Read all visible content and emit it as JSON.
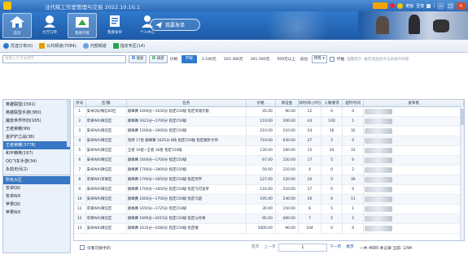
{
  "window": {
    "title": "注代练工作室管理与交易 2022.10.10.1",
    "controls": [
      "—",
      "□",
      "×"
    ]
  },
  "titlebar_right": {
    "user_label": "老板",
    "vip_label": "至尊",
    "separator": "|"
  },
  "ribbon": {
    "nav": [
      {
        "label": "首页",
        "icon": "home-icon"
      },
      {
        "label": "大厅订单",
        "icon": "order-hall-icon"
      },
      {
        "label": "我要代练",
        "icon": "level-up-icon"
      },
      {
        "label": "我要发单",
        "icon": "publish-doc-icon"
      },
      {
        "label": "个人中心",
        "icon": "user-icon"
      }
    ],
    "publish_button": "我要发单"
  },
  "tabs": [
    {
      "label": "优选订单(0)",
      "icon": "star-circle-icon",
      "color": "#2f79cc"
    },
    {
      "label": "公共频道(7084)",
      "icon": "broadcast-icon",
      "color": "#2f79cc"
    },
    {
      "label": "内部频道",
      "icon": "wifi-icon",
      "color": "#2f79cc"
    },
    {
      "label": "指定专区(14)",
      "icon": "check-icon",
      "color": "#2aa34a"
    }
  ],
  "filters": {
    "search_placeholder": "请输入订单关键字",
    "search_button": "搜索",
    "refresh_button": "刷新",
    "price_label": "价格:",
    "price_options": [
      "不限",
      "1-100元",
      "101-300元",
      "301-500元",
      "500元以上"
    ],
    "price_selected": "不限",
    "rank_label": "段位:",
    "rank_value": "所有",
    "checkbox_label": "代抽",
    "hint": "温馨提示: 推荐请直接点击表格内标题"
  },
  "sidebar": {
    "top_items": [
      "英雄联盟(1561)",
      "英雄联盟手游(380)",
      "魔兽世界怀旧(165)",
      "王者荣耀(99)",
      "金铲铲之战(38)",
      "王者荣耀(3778)",
      "和平精英(197)",
      "QQ飞车手游(34)",
      "永劫无间(2)"
    ],
    "selected_index": 5,
    "region_items": [
      "所有大区",
      "安卓QQ",
      "安卓WX",
      "苹果QQ",
      "苹果WX"
    ],
    "region_selected_index": 0
  },
  "table": {
    "columns": [
      "序号",
      "区/服",
      "任务",
      "价格",
      "保证金",
      "效时间(小时)",
      "入数要求",
      "超时时间",
      "发布者"
    ],
    "rows": [
      {
        "no": "1",
        "region": "安卓QQ/微信60区",
        "task": "巅峰赛 1600分~1650分 指定150级 指定英雄元歌",
        "price": "45.00",
        "deposit": "90.00",
        "hours": "12",
        "req": "0",
        "timeout": "0"
      },
      {
        "no": "2",
        "region": "苹果WX/微信区",
        "task": "巅峰赛 1621分~1700分 指定150级",
        "price": "110.00",
        "deposit": "200.00",
        "hours": "43",
        "req": "100",
        "timeout": "1"
      },
      {
        "no": "3",
        "region": "安卓WX/微信区",
        "task": "巅峰赛 1500分~1600分 指定150级",
        "price": "210.00",
        "deposit": "210.00",
        "hours": "24",
        "req": "16",
        "timeout": "32"
      },
      {
        "no": "4",
        "region": "安卓WX/微信区",
        "task": "金牌 17星 巅峰赛 1625分 8场 指定150级 指定脚步大师",
        "price": "710.00",
        "deposit": "630.00",
        "hours": "27",
        "req": "5",
        "timeout": "0"
      },
      {
        "no": "5",
        "region": "安卓WX/微信区",
        "task": "王者 10星~王者 30星 指定150级",
        "price": "130.00",
        "deposit": "160.00",
        "hours": "15",
        "req": "24",
        "timeout": "33"
      },
      {
        "no": "6",
        "region": "安卓WX/微信区",
        "task": "巅峰赛 1600分~1700分 指定150级",
        "price": "67.00",
        "deposit": "150.00",
        "hours": "17",
        "req": "5",
        "timeout": "0"
      },
      {
        "no": "7",
        "region": "安卓WX/微信区",
        "task": "巅峰赛 1760分~1800分 指定150级",
        "price": "50.00",
        "deposit": "210.00",
        "hours": "4",
        "req": "0",
        "timeout": "2"
      },
      {
        "no": "8",
        "region": "苹果WX/苹果区",
        "task": "巅峰赛 1700分~1850分 指定150级 指定周宇",
        "price": "127.00",
        "deposit": "120.00",
        "hours": "20",
        "req": "0",
        "timeout": "36"
      },
      {
        "no": "9",
        "region": "安卓WX/微信区",
        "task": "巅峰赛 1700分~1850分 指定150级 指定马可波罗",
        "price": "116.00",
        "deposit": "210.00",
        "hours": "17",
        "req": "0",
        "timeout": "0"
      },
      {
        "no": "10",
        "region": "安卓WX/微信区",
        "task": "巅峰赛 1605分~1700分 指定150级 指定马超",
        "price": "195.00",
        "deposit": "240.00",
        "hours": "20",
        "req": "6",
        "timeout": "11"
      },
      {
        "no": "11",
        "region": "苹果WX/微信区",
        "task": "巅峰赛 1650分~1725分 指定150级",
        "price": "30.00",
        "deposit": "150.00",
        "hours": "6",
        "req": "5",
        "timeout": "1"
      },
      {
        "no": "12",
        "region": "苹果WX/微信区",
        "task": "巅峰赛 1895分~2015分 指定150级 指定公孙离",
        "price": "95.00",
        "deposit": "400.00",
        "hours": "7",
        "req": "5",
        "timeout": "1"
      },
      {
        "no": "13",
        "region": "安卓WX/微信区",
        "task": "巅峰赛 1635分~2080分 指定150级 指定曜",
        "price": "1000.00",
        "deposit": "90.00",
        "hours": "104",
        "req": "0",
        "timeout": "0"
      }
    ]
  },
  "footer": {
    "checkbox_label": "仅看可接手的",
    "first": "首页",
    "prev": "上一页",
    "page": "1",
    "next": "下一页",
    "last": "尾页",
    "summary": "一共 4680 条记录  当前: 1/94"
  }
}
